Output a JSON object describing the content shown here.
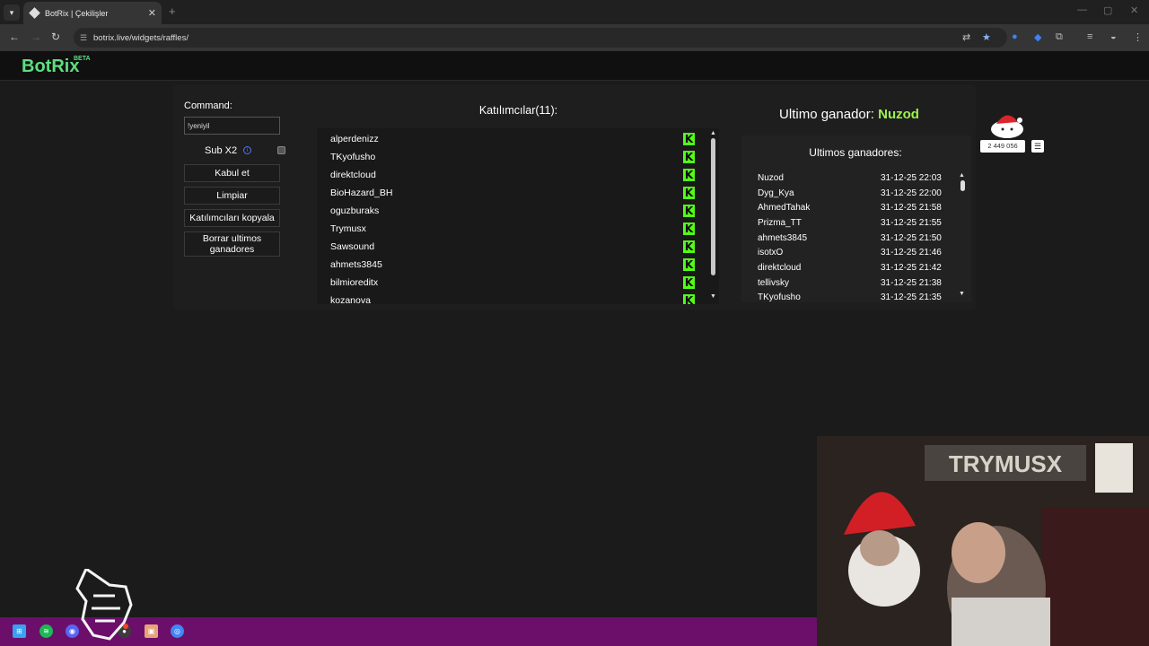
{
  "browser": {
    "tab_title": "BotRix | Çekilişler",
    "url": "botrix.live/widgets/raffles/"
  },
  "app": {
    "logo": "BotRix",
    "logo_badge": "BETA"
  },
  "controls": {
    "command_label": "Command:",
    "command_value": "!yeniyil",
    "sub_label": "Sub X2",
    "buttons": [
      "Kabul et",
      "Limpiar",
      "Katılımcıları kopyala",
      "Borrar ultimos ganadores"
    ]
  },
  "participants": {
    "title": "Katılımcılar(11):",
    "names": [
      "alperdenizz",
      "TKyofusho",
      "direktcloud",
      "BioHazard_BH",
      "oguzburaks",
      "Trymusx",
      "Sawsound",
      "ahmets3845",
      "bilmioreditx",
      "kozanova"
    ],
    "platform_icon": "kick-logo-icon",
    "platform_color": "#53fc18"
  },
  "last_winner": {
    "label": "Ultimo ganador:",
    "name": "Nuzod",
    "name_color": "#9ef24e"
  },
  "winners": {
    "title": "Ultimos ganadores:",
    "rows": [
      {
        "name": "Nuzod",
        "date": "31-12-25 22:03"
      },
      {
        "name": "Dyg_Kya",
        "date": "31-12-25 22:00"
      },
      {
        "name": "AhmedTahak",
        "date": "31-12-25 21:58"
      },
      {
        "name": "Prizma_TT",
        "date": "31-12-25 21:55"
      },
      {
        "name": "ahmets3845",
        "date": "31-12-25 21:50"
      },
      {
        "name": "isotxO",
        "date": "31-12-25 21:46"
      },
      {
        "name": "direktcloud",
        "date": "31-12-25 21:42"
      },
      {
        "name": "tellivsky",
        "date": "31-12-25 21:38"
      },
      {
        "name": "TKyofusho",
        "date": "31-12-25 21:35"
      }
    ]
  },
  "stream_overlay": {
    "counter": "2 449 056",
    "webcam_sign": "TRYMUSX"
  },
  "colors": {
    "brand_green": "#5ede7f",
    "taskbar": "#6b0f6b"
  }
}
